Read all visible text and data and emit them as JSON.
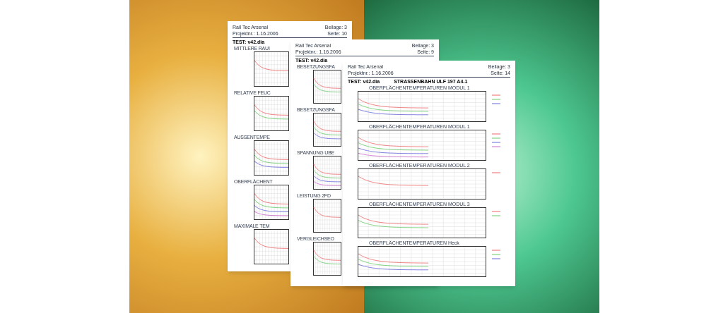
{
  "documents": [
    {
      "company": "Rail Tec Arsenal",
      "attachment": "Beilage: 3",
      "project": "Projektnr.: 1.16.2006",
      "page": "Seite: 10",
      "test": "TEST: v42.dia",
      "charts": [
        {
          "title": "MITTLERE RAUI"
        },
        {
          "title": "RELATIVE FEUC"
        },
        {
          "title": "AUSSENTEMPE"
        },
        {
          "title": "OBERFLÄCHENT"
        },
        {
          "title": "MAXIMALE TEM"
        }
      ]
    },
    {
      "company": "Rail Tec Arsenal",
      "attachment": "Beilage: 3",
      "project": "Projektnr.: 1.16.2006",
      "page": "Seite: 9",
      "test": "TEST: v42.dia",
      "charts": [
        {
          "title": "BESETZUNGSFA"
        },
        {
          "title": "BESETZUNGSFA"
        },
        {
          "title": "SPANNUNG UBE"
        },
        {
          "title": "LEISTUNG 2FD"
        },
        {
          "title": "VERGLEICHSEO"
        }
      ]
    },
    {
      "company": "Rail Tec Arsenal",
      "attachment": "Beilage: 3",
      "project": "Projektnr.: 1.16.2006",
      "page": "Seite: 14",
      "test": "TEST: v42.dia",
      "title": "STRASSENBAHN ULF 197 A4-1",
      "charts": [
        {
          "title": "OBERFLÄCHENTEMPERATUREN MODUL 1"
        },
        {
          "title": "OBERFLÄCHENTEMPERATUREN MODUL 1"
        },
        {
          "title": "OBERFLÄCHENTEMPERATUREN MODUL 2"
        },
        {
          "title": "OBERFLÄCHENTEMPERATUREN MODUL 3"
        },
        {
          "title": "OBERFLÄCHENTEMPERATUREN Heck"
        }
      ]
    }
  ]
}
